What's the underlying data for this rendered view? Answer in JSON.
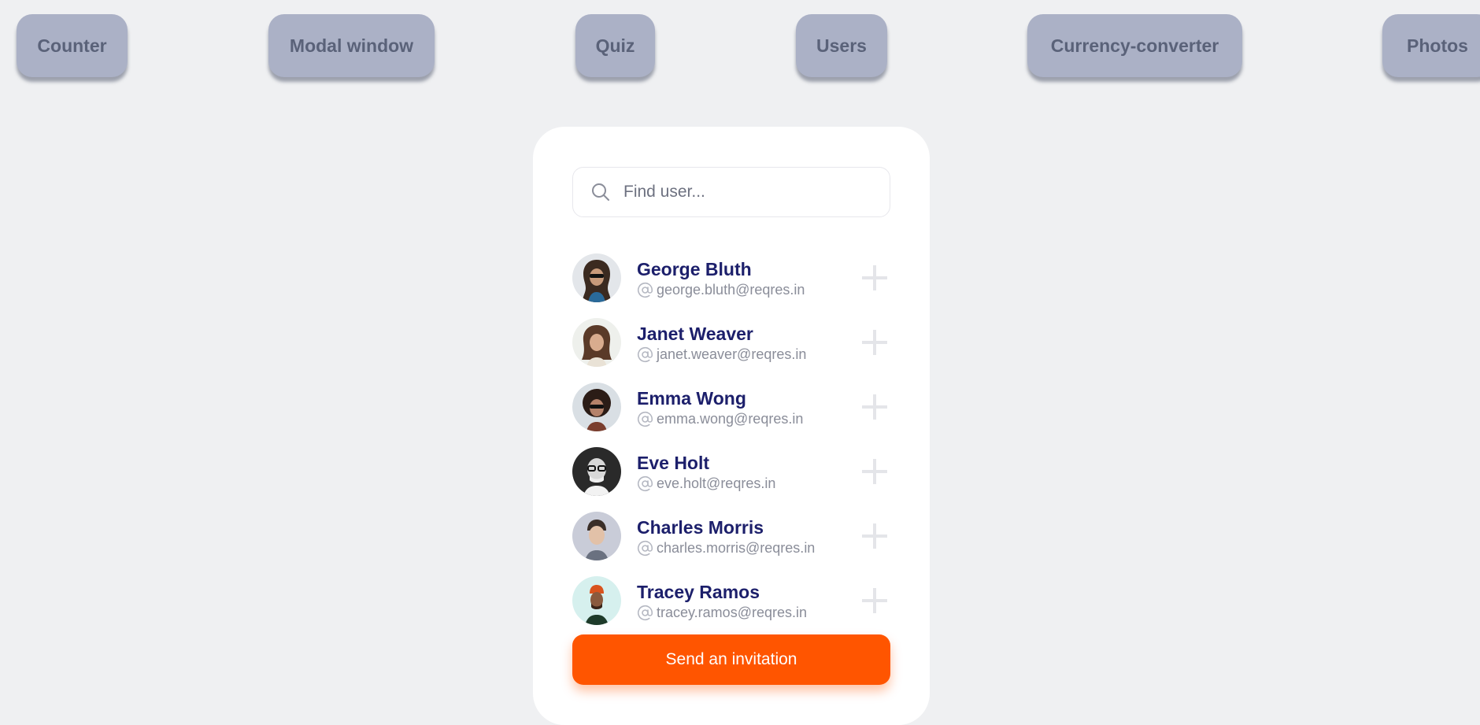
{
  "nav": {
    "items": [
      {
        "label": "Counter"
      },
      {
        "label": "Modal window"
      },
      {
        "label": "Quiz"
      },
      {
        "label": "Users"
      },
      {
        "label": "Currency-converter"
      },
      {
        "label": "Photos"
      }
    ]
  },
  "search": {
    "placeholder": "Find user...",
    "value": "",
    "icon": "search-icon"
  },
  "users": [
    {
      "name": "George Bluth",
      "email": "george.bluth@reqres.in"
    },
    {
      "name": "Janet Weaver",
      "email": "janet.weaver@reqres.in"
    },
    {
      "name": "Emma Wong",
      "email": "emma.wong@reqres.in"
    },
    {
      "name": "Eve Holt",
      "email": "eve.holt@reqres.in"
    },
    {
      "name": "Charles Morris",
      "email": "charles.morris@reqres.in"
    },
    {
      "name": "Tracey Ramos",
      "email": "tracey.ramos@reqres.in"
    }
  ],
  "send_button": {
    "label": "Send an invitation"
  },
  "colors": {
    "background": "#eff0f2",
    "nav_button": "#abb1c6",
    "nav_text": "#5a6279",
    "name_text": "#1c1f6b",
    "email_text": "#8a8d99",
    "accent": "#ff5500"
  }
}
